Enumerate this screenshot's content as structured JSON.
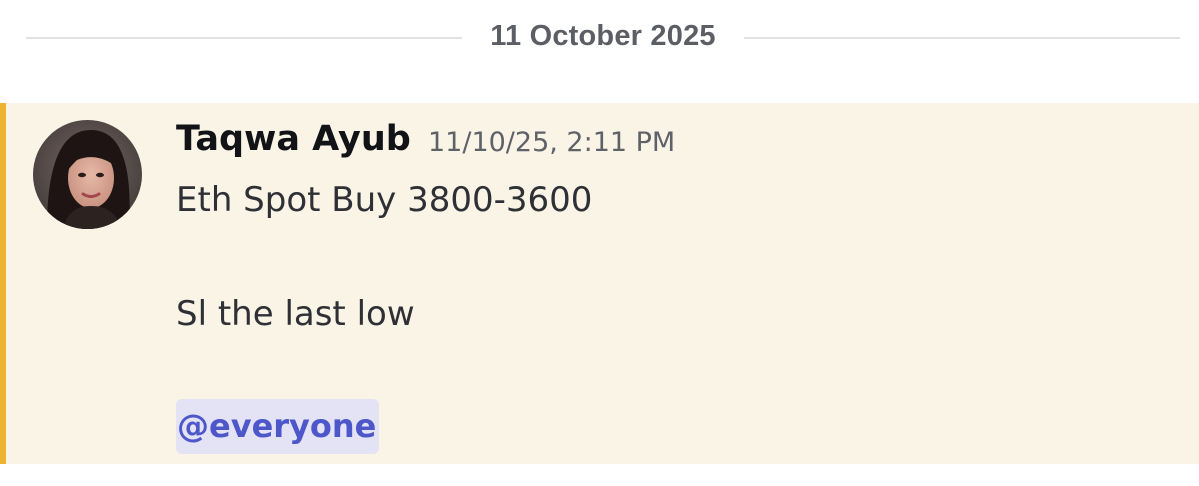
{
  "divider": {
    "date": "11 October 2025"
  },
  "message": {
    "author": "Taqwa Ayub",
    "timestamp": "11/10/25, 2:11 PM",
    "lines": [
      "Eth Spot Buy 3800-3600",
      "Sl the last low"
    ],
    "mention": "@everyone",
    "highlighted": true
  },
  "colors": {
    "highlight_background": "#faf4e7",
    "mention_bar": "#f0b232",
    "mention_text": "#4d57c9",
    "mention_background": "#e4e3f5",
    "divider_line": "#e1e2e5"
  },
  "icons": {
    "avatar": "user-avatar-photo"
  }
}
